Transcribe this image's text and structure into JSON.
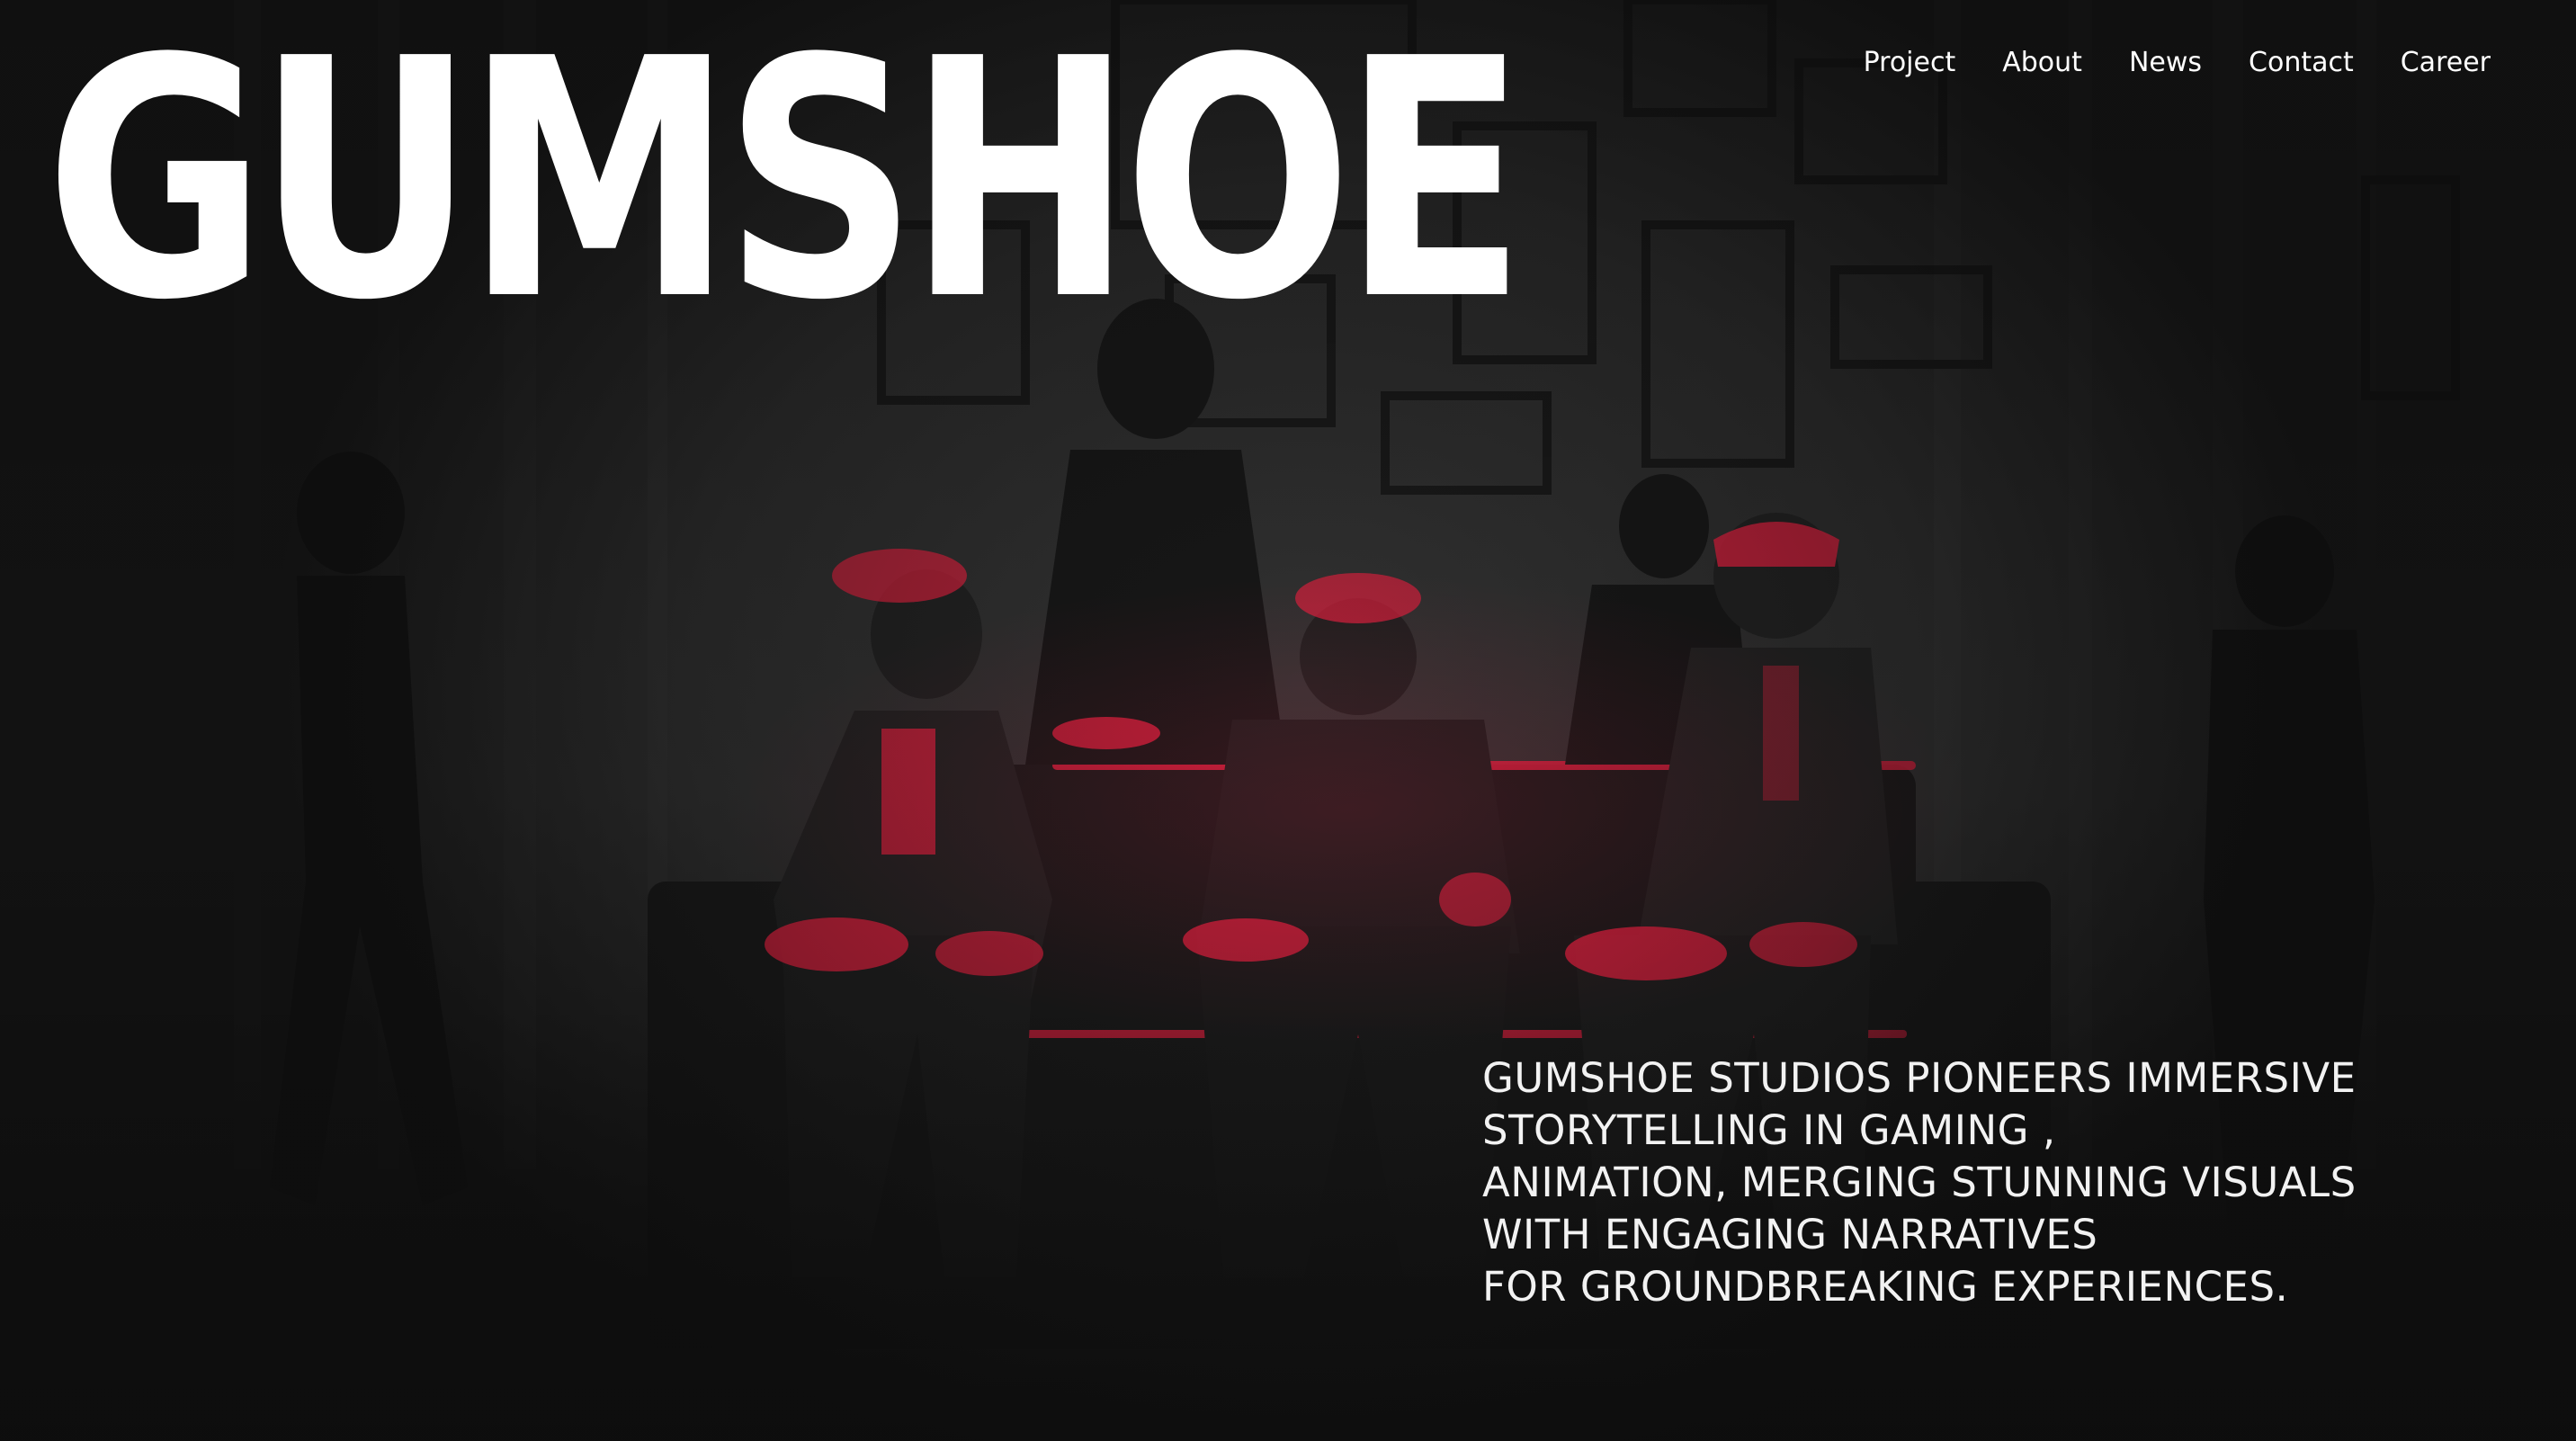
{
  "brand": {
    "logo_text": "GUMSHOE"
  },
  "nav": {
    "items": [
      {
        "label": "Project"
      },
      {
        "label": "About"
      },
      {
        "label": "News"
      },
      {
        "label": "Contact"
      },
      {
        "label": "Career"
      }
    ]
  },
  "hero": {
    "image": "noir group of characters seated on a sofa with silhouettes standing behind, red-highlighted",
    "tagline": "GUMSHOE STUDIOS PIONEERS IMMERSIVE\nSTORYTELLING IN GAMING ,\nANIMATION, MERGING STUNNING VISUALS\nWITH ENGAGING NARRATIVES\nFOR GROUNDBREAKING EXPERIENCES."
  },
  "colors": {
    "background": "#1c1c1c",
    "accent_red": "#e0213f",
    "text": "#ffffff"
  }
}
